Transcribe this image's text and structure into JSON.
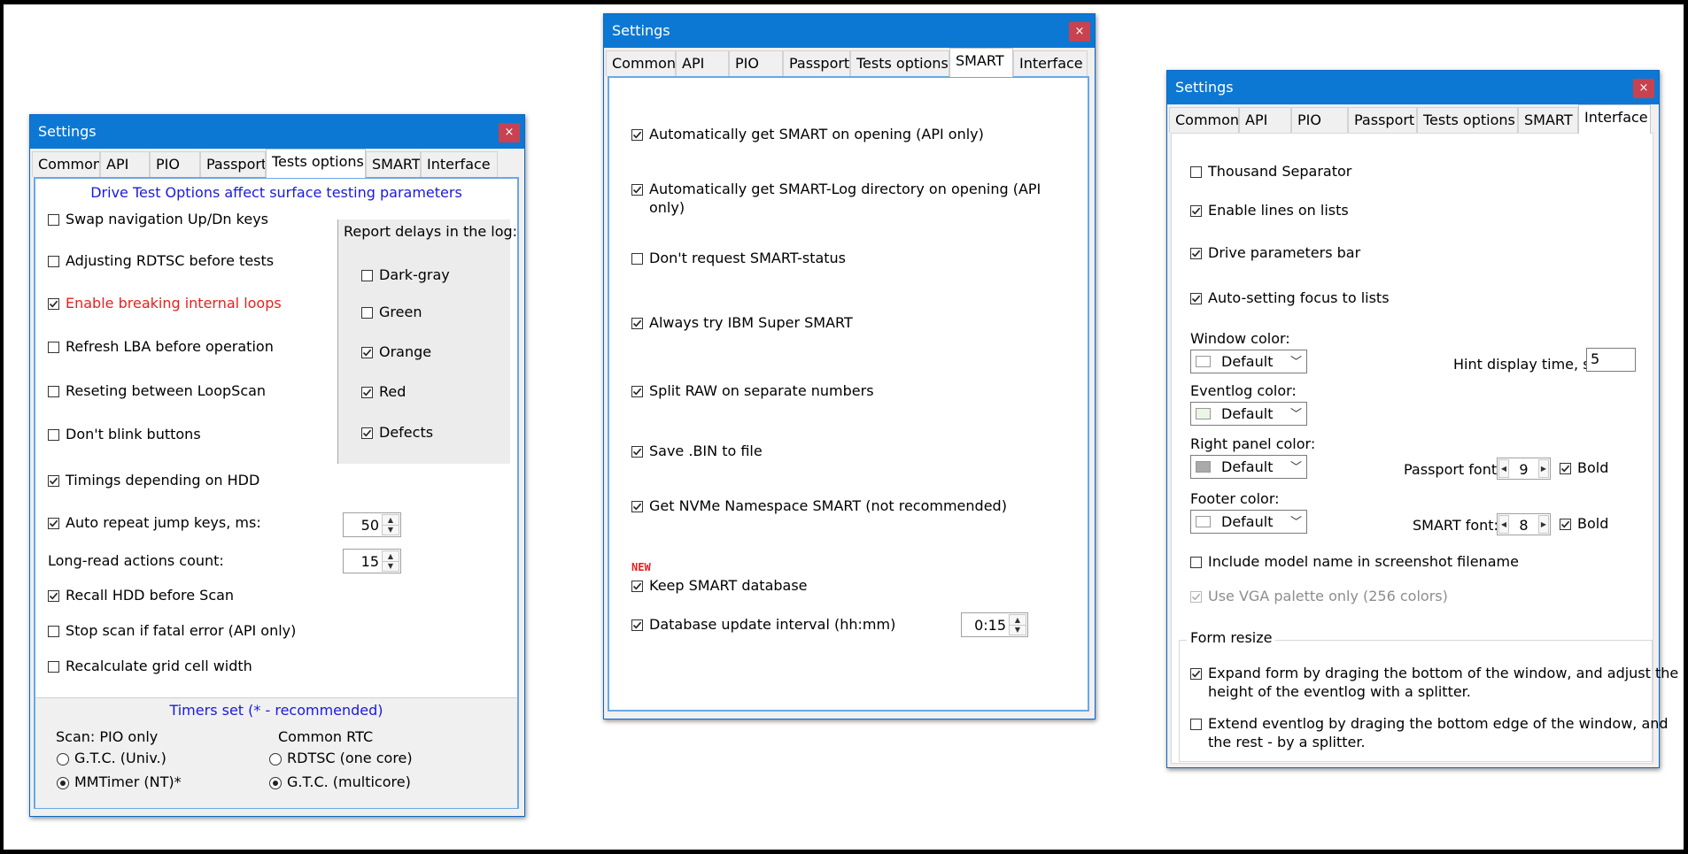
{
  "windows": {
    "left": {
      "title": "Settings",
      "close": "×",
      "tabs": [
        "Common",
        "API",
        "PIO",
        "Passport",
        "Tests options",
        "SMART",
        "Interface"
      ],
      "active_tab": "Tests options",
      "header": "Drive Test Options affect surface testing parameters",
      "options": [
        {
          "label": "Swap navigation Up/Dn keys",
          "checked": false
        },
        {
          "label": "Adjusting RDTSC before tests",
          "checked": false
        },
        {
          "label": "Enable breaking internal loops",
          "checked": true
        },
        {
          "label": "Refresh LBA before operation",
          "checked": false
        },
        {
          "label": "Reseting between LoopScan",
          "checked": false
        },
        {
          "label": "Don't blink buttons",
          "checked": false
        },
        {
          "label": "Timings depending on HDD",
          "checked": true
        },
        {
          "label": "Auto repeat jump keys, ms:",
          "checked": true
        }
      ],
      "auto_repeat_value": "50",
      "long_read_label": "Long-read actions count:",
      "long_read_value": "15",
      "options2": [
        {
          "label": "Recall HDD before Scan",
          "checked": true
        },
        {
          "label": "Stop scan if fatal error (API only)",
          "checked": false
        },
        {
          "label": "Recalculate grid cell width",
          "checked": false
        }
      ],
      "report_group": {
        "title": "Report delays in the log:",
        "items": [
          {
            "label": "Dark-gray",
            "checked": false
          },
          {
            "label": "Green",
            "checked": false
          },
          {
            "label": "Orange",
            "checked": true
          },
          {
            "label": "Red",
            "checked": true
          },
          {
            "label": "Defects",
            "checked": true
          }
        ]
      },
      "timers": {
        "title": "Timers set  (* - recommended)",
        "scan_title": "Scan: PIO only",
        "scan_options": [
          {
            "label": "G.T.C. (Univ.)",
            "selected": false
          },
          {
            "label": "MMTimer (NT)*",
            "selected": true
          }
        ],
        "rtc_title": "Common RTC",
        "rtc_options": [
          {
            "label": "RDTSC (one core)",
            "selected": false
          },
          {
            "label": "G.T.C.  (multicore)",
            "selected": true
          }
        ]
      },
      "colors": {
        "red_label": "#e8201e",
        "blue_label": "#1a1adc"
      }
    },
    "middle": {
      "title": "Settings",
      "close": "×",
      "tabs": [
        "Common",
        "API",
        "PIO",
        "Passport",
        "Tests options",
        "SMART",
        "Interface"
      ],
      "active_tab": "SMART",
      "options": [
        {
          "label": "Automatically get SMART on opening (API only)",
          "checked": true
        },
        {
          "label": "Automatically get SMART-Log directory on opening (API",
          "label2": "only)",
          "checked": true
        },
        {
          "label": "Don't request SMART-status",
          "checked": false
        },
        {
          "label": "Always try IBM Super SMART",
          "checked": true
        },
        {
          "label": "Split RAW on separate numbers",
          "checked": true
        },
        {
          "label": "Save .BIN to file",
          "checked": true
        },
        {
          "label": "Get NVMe Namespace SMART (not recommended)",
          "checked": true
        }
      ],
      "new_badge": "NEW",
      "options_new": [
        {
          "label": "Keep SMART database",
          "checked": true
        },
        {
          "label": "Database update interval (hh:mm)",
          "checked": true
        }
      ],
      "interval_value": "0:15"
    },
    "right": {
      "title": "Settings",
      "close": "×",
      "tabs": [
        "Common",
        "API",
        "PIO",
        "Passport",
        "Tests options",
        "SMART",
        "Interface"
      ],
      "active_tab": "Interface",
      "options": [
        {
          "label": "Thousand Separator",
          "checked": false
        },
        {
          "label": "Enable lines on lists",
          "checked": true
        },
        {
          "label": "Drive parameters bar",
          "checked": true
        },
        {
          "label": "Auto-setting focus to lists",
          "checked": true
        }
      ],
      "window_color": {
        "label": "Window color:",
        "value": "Default"
      },
      "eventlog_color": {
        "label": "Eventlog color:",
        "value": "Default"
      },
      "right_panel_color": {
        "label": "Right panel color:",
        "value": "Default"
      },
      "footer_color": {
        "label": "Footer color:",
        "value": "Default"
      },
      "hint_label": "Hint display time, s:",
      "hint_value": "5",
      "passport_font": {
        "label": "Passport font:",
        "value": "9",
        "bold_label": "Bold",
        "bold": true
      },
      "smart_font": {
        "label": "SMART font:",
        "value": "8",
        "bold_label": "Bold",
        "bold": true
      },
      "include_model": {
        "label": "Include model name in screenshot filename",
        "checked": false
      },
      "vga_palette": {
        "label": "Use VGA palette only (256 colors)",
        "checked": true,
        "disabled": true
      },
      "form_resize": {
        "title": "Form resize",
        "options": [
          {
            "label": "Expand form by draging the bottom of the window, and adjust the",
            "label2": "height of the eventlog with a splitter.",
            "checked": true
          },
          {
            "label": "Extend eventlog by draging the bottom edge of the window, and",
            "label2": "the rest - by a splitter.",
            "checked": false
          }
        ]
      },
      "swatch_colors": {
        "default": "#ffffff",
        "eventlog": "#eaf5e6",
        "right_panel": "#a9a9a9"
      }
    }
  }
}
